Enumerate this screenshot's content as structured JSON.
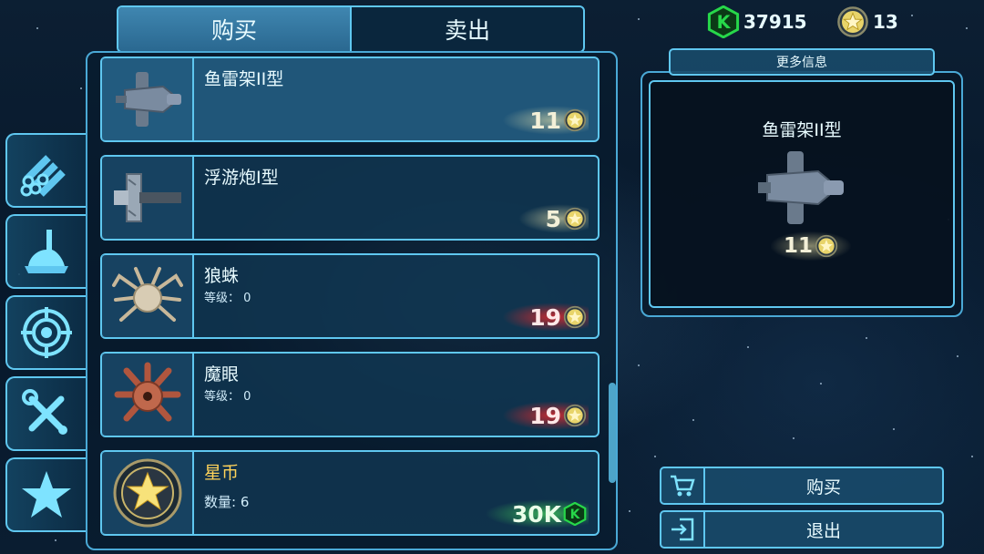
{
  "tabs": {
    "buy_label": "购买",
    "sell_label": "卖出",
    "active": "buy"
  },
  "currency": {
    "gems": "37915",
    "stars": "13"
  },
  "categories": [
    "pipes-icon",
    "crane-icon",
    "target-icon",
    "tools-icon",
    "star-icon"
  ],
  "items": [
    {
      "name": "鱼雷架II型",
      "sub": "",
      "price": "11",
      "price_type": "star",
      "price_glow": "gold"
    },
    {
      "name": "浮游炮I型",
      "sub": "",
      "price": "5",
      "price_type": "star",
      "price_glow": "gold"
    },
    {
      "name": "狼蛛",
      "sub": "等级： 0",
      "price": "19",
      "price_type": "star",
      "price_glow": "red"
    },
    {
      "name": "魔眼",
      "sub": "等级： 0",
      "price": "19",
      "price_type": "star",
      "price_glow": "red"
    },
    {
      "name": "星币",
      "sub": "数量: 6",
      "price": "30K",
      "price_type": "gem",
      "price_glow": "green"
    }
  ],
  "info": {
    "header": "更多信息",
    "name": "鱼雷架II型",
    "price": "11"
  },
  "actions": {
    "buy_label": "购买",
    "exit_label": "退出"
  },
  "colors": {
    "accent": "#5fc7f0",
    "gem": "#27d84a",
    "star": "#f2c531",
    "price_red": "#ff2828"
  }
}
